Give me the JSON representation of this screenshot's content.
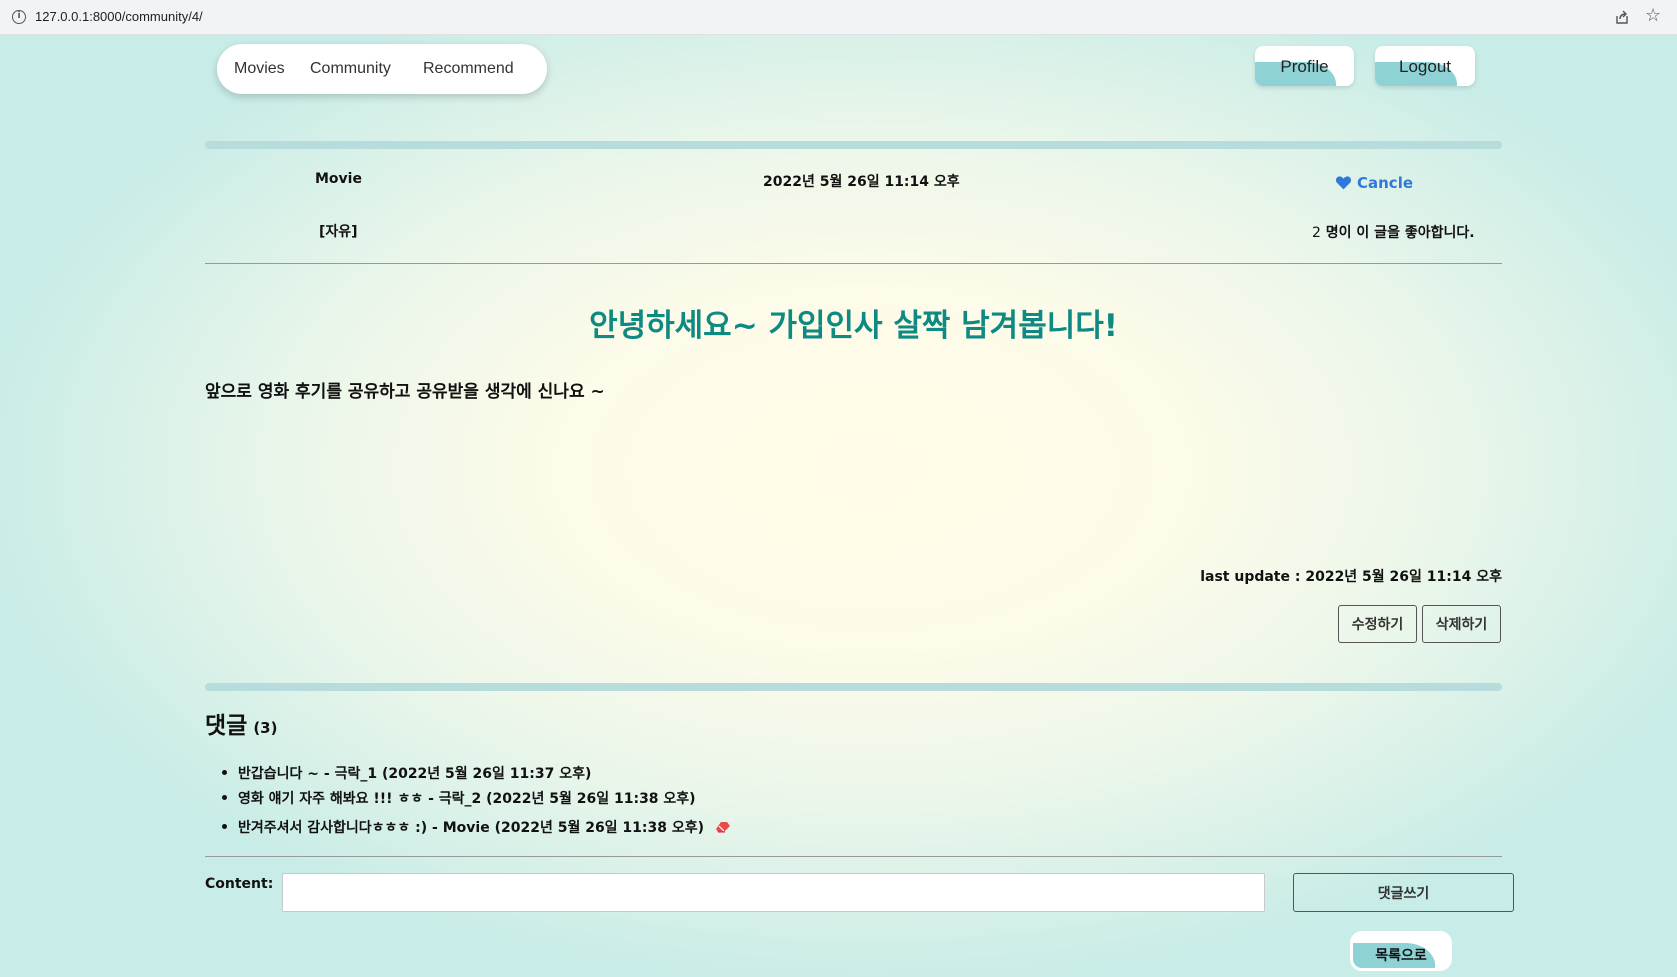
{
  "browser": {
    "url": "127.0.0.1:8000/community/4/"
  },
  "nav": {
    "links": [
      "Movies",
      "Community",
      "Recommend"
    ],
    "profile_label": "Profile",
    "logout_label": "Logout"
  },
  "post": {
    "author": "Movie",
    "created_at": "2022년 5월 26일 11:14 오후",
    "category": "[자유]",
    "like_action_label": "Cancle",
    "like_count": "2",
    "like_text": "명이 이 글을 좋아합니다.",
    "title": "안녕하세요~ 가입인사 살짝 남겨봅니다!",
    "content": "앞으로 영화 후기를 공유하고 공유받을 생각에 신나요 ~",
    "last_update": "last update : 2022년 5월 26일 11:14 오후",
    "edit_label": "수정하기",
    "delete_label": "삭제하기"
  },
  "comments": {
    "heading": "댓글",
    "count": "(3)",
    "items": [
      "반갑습니다 ~ - 극락_1 (2022년 5월 26일 11:37 오후)",
      "영화 얘기 자주 해봐요 !!! ㅎㅎ - 극락_2 (2022년 5월 26일 11:38 오후)",
      "반겨주셔서 감사합니다ㅎㅎㅎ :) - Movie (2022년 5월 26일 11:38 오후)"
    ],
    "content_label": "Content:",
    "submit_label": "댓글쓰기"
  },
  "back_label": "목록으로",
  "colors": {
    "accent_teal": "#0f8a82",
    "button_accent": "#8ed2d6",
    "link_blue": "#2f7ad9"
  }
}
